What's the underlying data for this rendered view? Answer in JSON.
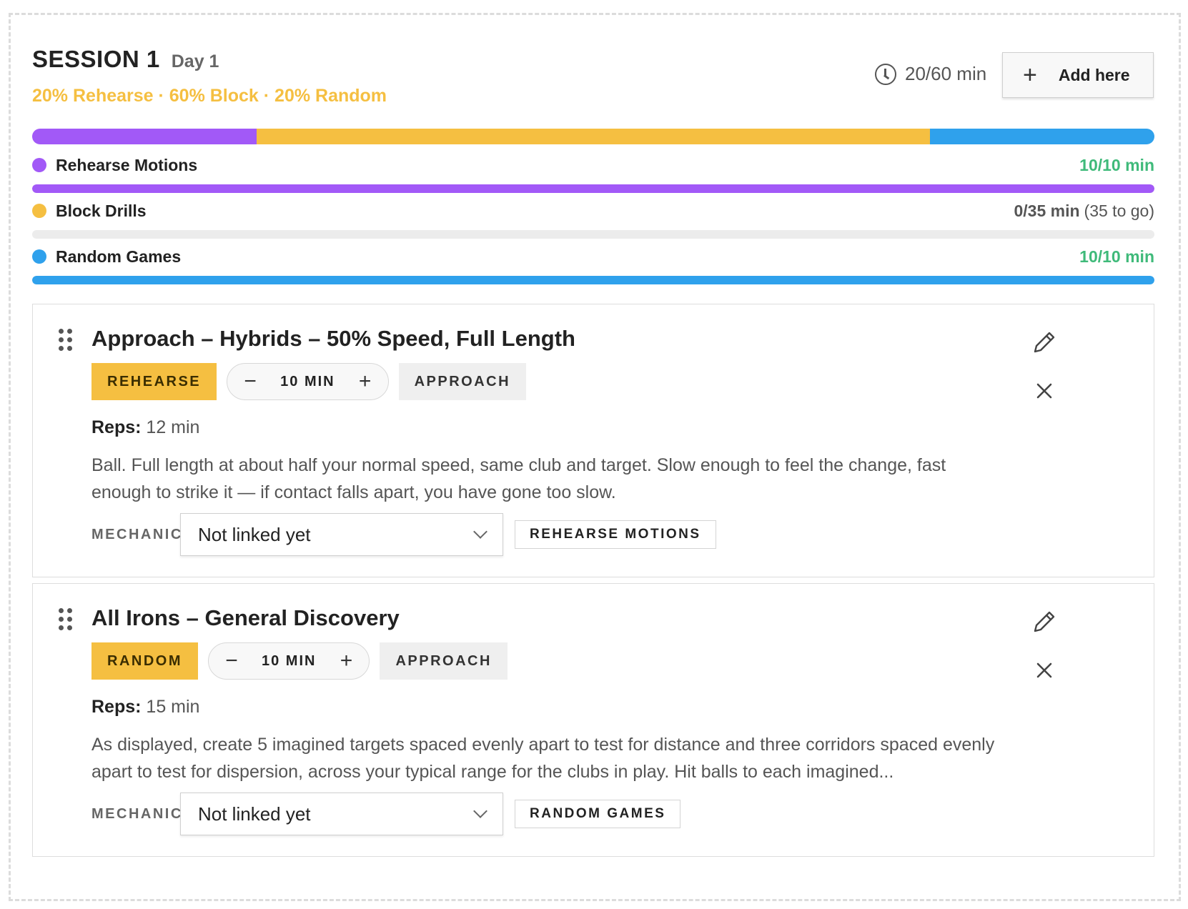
{
  "session": {
    "title": "SESSION 1",
    "day": "Day 1",
    "split": "20% Rehearse · 60% Block · 20% Random",
    "timer": "20/60 min",
    "add_label": "Add here",
    "bar_fractions": [
      0.2,
      0.6,
      0.2
    ],
    "colors": {
      "rehearse": "#a259f7",
      "block": "#f5bf41",
      "random": "#2fa1ec"
    }
  },
  "categories": [
    {
      "name": "Rehearse Motions",
      "mins": "10/10 min",
      "togo": "",
      "progress": 1.0
    },
    {
      "name": "Block Drills",
      "mins": "0/35 min",
      "togo": "(35 to go)",
      "progress": 0.0
    },
    {
      "name": "Random Games",
      "mins": "10/10 min",
      "togo": "",
      "progress": 1.0
    }
  ],
  "drills": [
    {
      "title": "Approach – Hybrids – 50% Speed, Full Length",
      "type": "REHEARSE",
      "duration": "10 MIN",
      "category": "APPROACH",
      "reps_label": "Reps:",
      "reps_value": "12 min",
      "description": "Ball. Full length at about half your normal speed, same club and target. Slow enough to feel the change, fast enough to strike it — if contact falls apart, you have gone too slow.",
      "mechanic_label": "MECHANIC",
      "mechanic_value": "Not linked yet",
      "mechanic_category": "REHEARSE MOTIONS"
    },
    {
      "title": "All Irons – General Discovery",
      "type": "RANDOM",
      "duration": "10 MIN",
      "category": "APPROACH",
      "reps_label": "Reps:",
      "reps_value": "15 min",
      "description": "As displayed, create 5 imagined targets spaced evenly apart to test for distance and three corridors spaced evenly apart to test for dispersion, across your typical range for the clubs in play. Hit balls to each imagined...",
      "mechanic_label": "MECHANIC",
      "mechanic_value": "Not linked yet",
      "mechanic_category": "RANDOM GAMES"
    }
  ]
}
